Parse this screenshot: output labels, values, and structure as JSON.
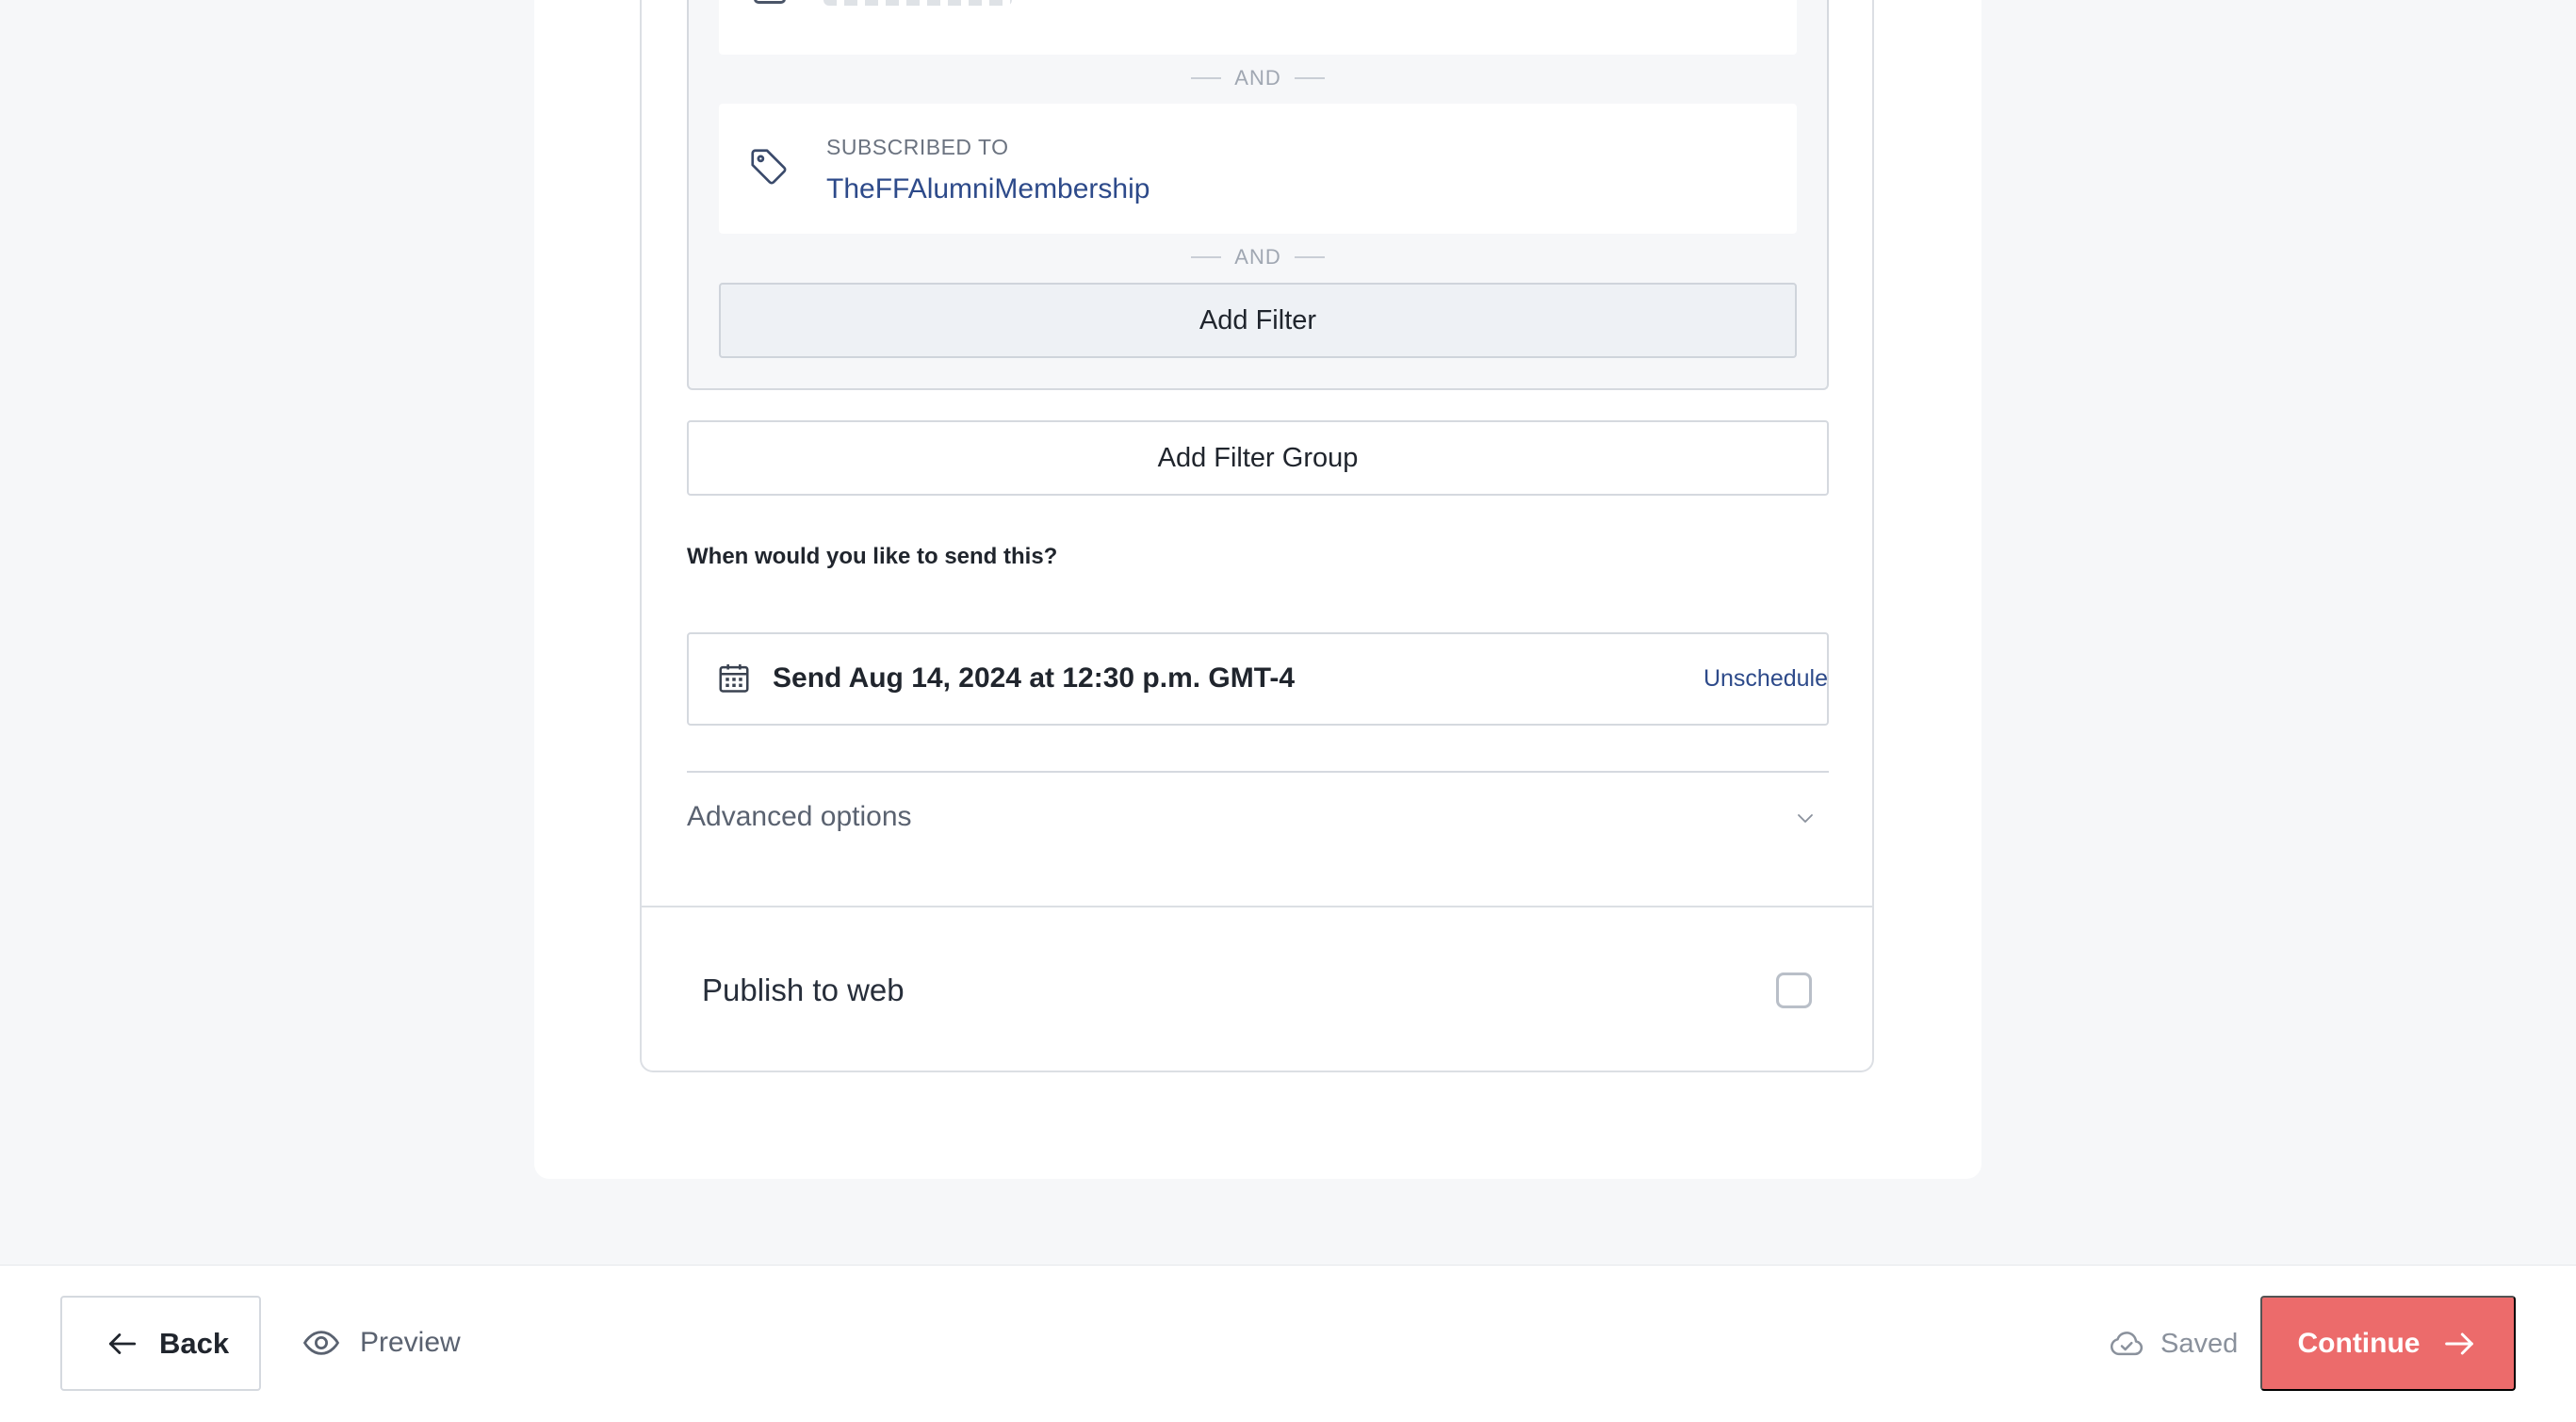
{
  "filters": {
    "separator_label": "AND",
    "subscription": {
      "label": "SUBSCRIBED TO",
      "value": "TheFFAlumniMembership",
      "icon": "tag-icon"
    },
    "add_filter_label": "Add Filter",
    "add_filter_group_label": "Add Filter Group"
  },
  "schedule": {
    "question": "When would you like to send this?",
    "text": "Send Aug 14, 2024 at 12:30 p.m. GMT-4",
    "unschedule_label": "Unschedule",
    "icon": "calendar-icon"
  },
  "advanced": {
    "label": "Advanced options",
    "icon": "chevron-down-icon"
  },
  "publish": {
    "label": "Publish to web",
    "checked": false
  },
  "footer": {
    "back_label": "Back",
    "preview_label": "Preview",
    "saved_label": "Saved",
    "continue_label": "Continue",
    "continue_color": "#ec6b6b"
  }
}
